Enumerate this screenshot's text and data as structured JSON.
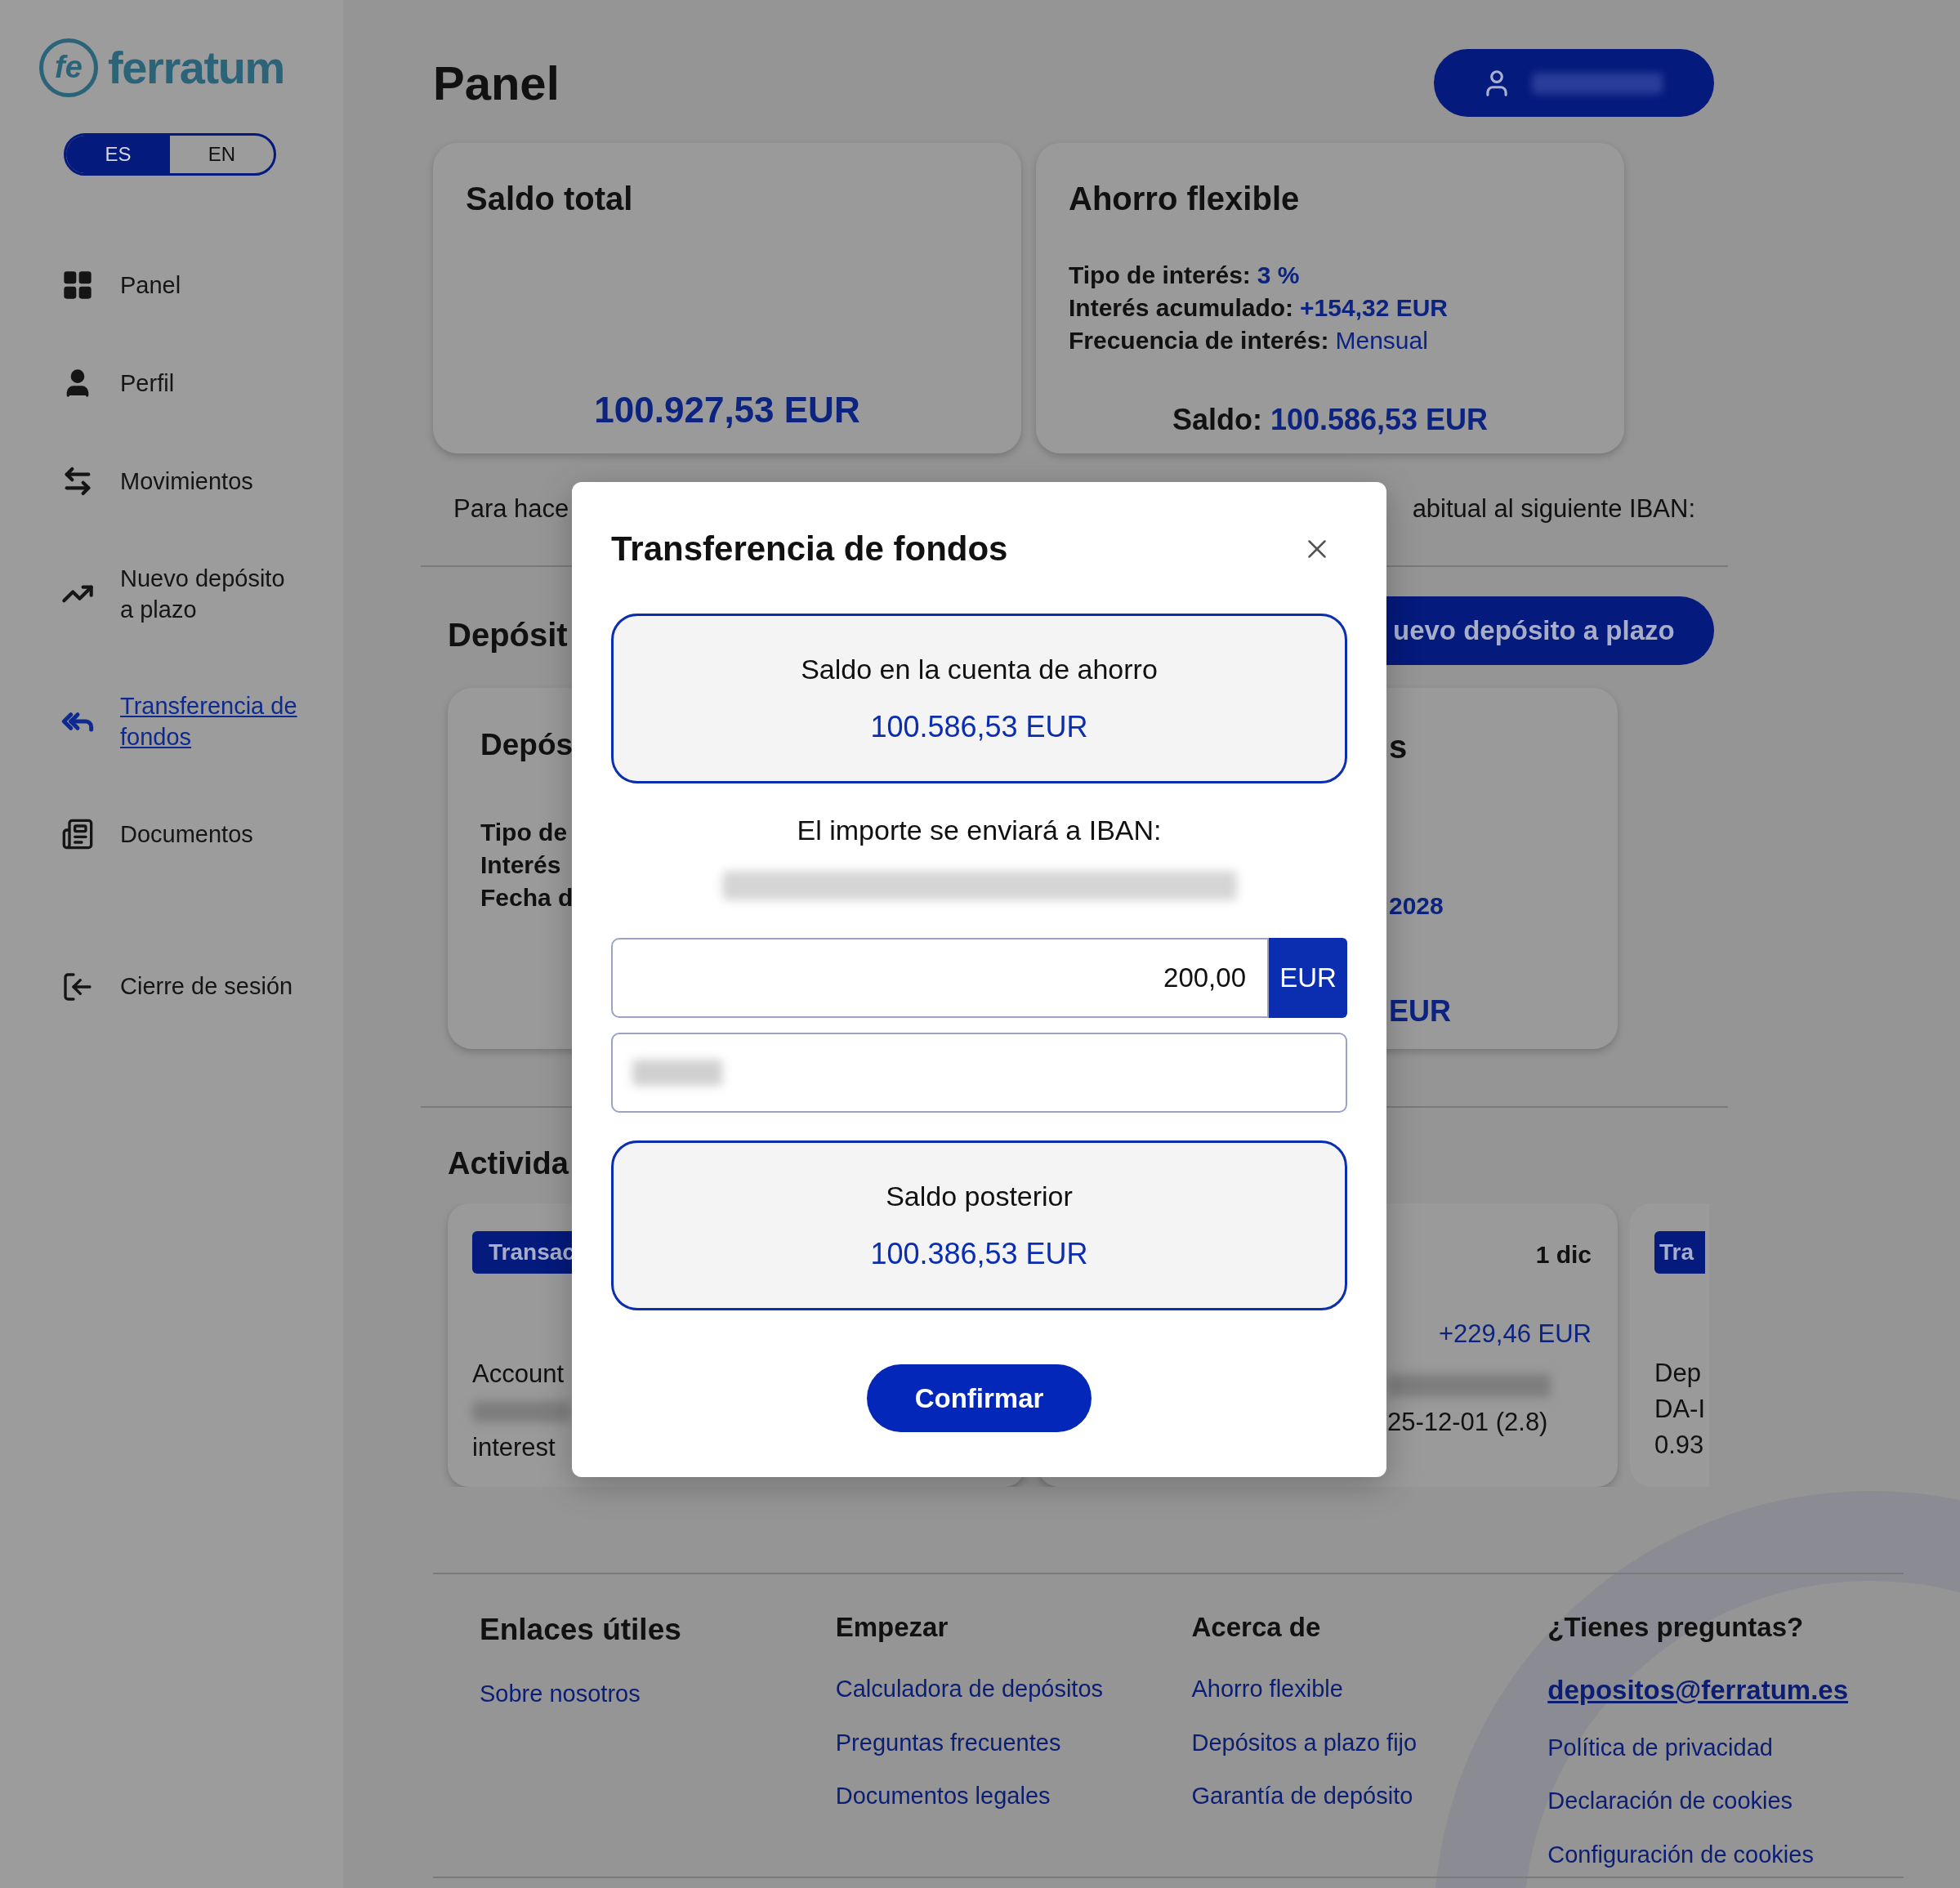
{
  "sidebar": {
    "logo": {
      "mark": "fe",
      "name": "ferratum"
    },
    "languages": [
      {
        "label": "ES",
        "selected": true
      },
      {
        "label": "EN",
        "selected": false
      }
    ],
    "nav": [
      {
        "lines": [
          "Panel"
        ],
        "selected": false
      },
      {
        "lines": [
          "Perfil"
        ],
        "selected": false
      },
      {
        "lines": [
          "Movimientos"
        ],
        "selected": false
      },
      {
        "lines": [
          "Nuevo depósito",
          "a plazo"
        ],
        "selected": false
      },
      {
        "lines": [
          "Transferencia de",
          "fondos"
        ],
        "selected": true
      },
      {
        "lines": [
          "Documentos"
        ],
        "selected": false
      }
    ],
    "logout": "Cierre de sesión"
  },
  "header": {
    "title": "Panel"
  },
  "summary_cards": {
    "total": {
      "title": "Saldo total",
      "amount": "100.927,53 EUR"
    },
    "savings": {
      "title": "Ahorro flexible",
      "rows": [
        {
          "label": "Tipo de interés:",
          "value": "3 %",
          "bold": true
        },
        {
          "label": "Interés acumulado:",
          "value": "+154,32 EUR",
          "bold": true
        },
        {
          "label": "Frecuencia de interés:",
          "value": "Mensual",
          "bold": false
        }
      ],
      "balance_label": "Saldo:",
      "balance_value": "100.586,53 EUR"
    }
  },
  "transfer_note": {
    "left": "Para hace",
    "right": "abitual al siguiente IBAN:"
  },
  "deposits": {
    "heading": "Depósit",
    "button": "uevo depósito a plazo",
    "left_card": {
      "title": "Depós",
      "lines": [
        "Tipo de",
        "Interés",
        "Fecha d"
      ]
    },
    "right_card": {
      "title": "s",
      "date": "2028",
      "amount": "EUR"
    }
  },
  "activity": {
    "heading": "Activida",
    "cards": [
      {
        "badge": "Transac",
        "lines": [
          "Account",
          "interest"
        ]
      },
      {
        "date": "1 dic",
        "amount": "+229,46 EUR",
        "detail": "25-12-01 (2.8)"
      },
      {
        "badge": "Tra",
        "lines": [
          "Dep",
          "DA-I",
          "0.93"
        ]
      }
    ]
  },
  "footer": {
    "columns": [
      {
        "heading": "Enlaces útiles",
        "links": [
          "Sobre nosotros"
        ]
      },
      {
        "heading": "Empezar",
        "links": [
          "Calculadora de depósitos",
          "Preguntas frecuentes",
          "Documentos legales"
        ]
      },
      {
        "heading": "Acerca de",
        "links": [
          "Ahorro flexible",
          "Depósitos a plazo fijo",
          "Garantía de depósito"
        ]
      },
      {
        "heading": "¿Tienes preguntas?",
        "email": "depositos@ferratum.es",
        "links": [
          "Política de privacidad",
          "Declaración de cookies",
          "Configuración de cookies"
        ]
      }
    ]
  },
  "modal": {
    "title": "Transferencia de fondos",
    "balance_box": {
      "label": "Saldo en la cuenta de ahorro",
      "amount": "100.586,53 EUR"
    },
    "iban_label": "El importe se enviará a IBAN:",
    "amount_field": {
      "value": "200,00",
      "currency": "EUR"
    },
    "result_box": {
      "label": "Saldo posterior",
      "amount": "100.386,53 EUR"
    },
    "confirm": "Confirmar"
  }
}
